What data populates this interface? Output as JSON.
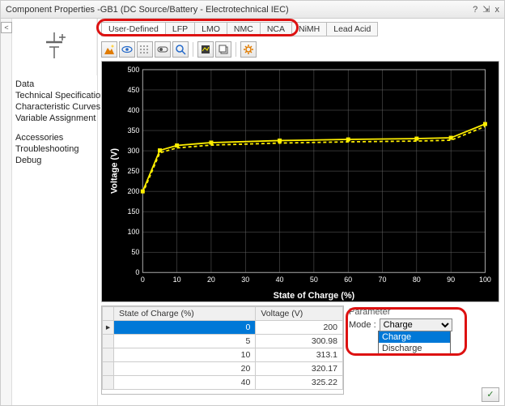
{
  "window": {
    "title": "Component Properties -GB1 (DC Source/Battery - Electrotechnical IEC)",
    "help_glyph": "?",
    "pin_glyph": "⇲",
    "close_glyph": "x"
  },
  "sidebar": {
    "collapse_glyph": "<",
    "nav": {
      "data": "Data",
      "tech_spec": "Technical Specifications",
      "curves": "Characteristic Curves",
      "var_assign": "Variable Assignment",
      "accessories": "Accessories",
      "troubleshooting": "Troubleshooting",
      "debug": "Debug"
    }
  },
  "tabs": {
    "user_defined": "User-Defined",
    "lfp": "LFP",
    "lmo": "LMO",
    "nmc": "NMC",
    "nca": "NCA",
    "nimh": "NiMH",
    "lead_acid": "Lead Acid"
  },
  "toolbar": {
    "icon1": "mountain-icon",
    "icon2": "eye-icon",
    "icon3": "grid-dash-icon",
    "icon4": "toggle-icon",
    "icon5": "zoom-icon",
    "icon6": "style-icon",
    "icon7": "copy-icon",
    "icon8": "gear-icon"
  },
  "chart_data": {
    "type": "line",
    "xlabel": "State of Charge (%)",
    "ylabel": "Voltage (V)",
    "xlim": [
      0,
      100
    ],
    "ylim": [
      0,
      500
    ],
    "xticks": [
      0,
      10,
      20,
      30,
      40,
      50,
      60,
      70,
      80,
      90,
      100
    ],
    "yticks": [
      0,
      50,
      100,
      150,
      200,
      250,
      300,
      350,
      400,
      450,
      500
    ],
    "series": [
      {
        "name": "solid",
        "style": "solid",
        "x": [
          0,
          5,
          10,
          20,
          40,
          60,
          80,
          90,
          100
        ],
        "y": [
          200,
          300.98,
          313.1,
          320.17,
          325.22,
          328,
          330,
          332,
          366
        ]
      },
      {
        "name": "dashed",
        "style": "dashed",
        "x": [
          0,
          5,
          10,
          20,
          40,
          60,
          80,
          90,
          100
        ],
        "y": [
          195,
          295,
          307,
          314,
          319,
          322,
          324,
          326,
          360
        ]
      }
    ],
    "colors": {
      "line": "#ffef00",
      "marker": "#ffef00",
      "grid": "#666",
      "bg": "#000"
    }
  },
  "table": {
    "col_soc": "State of Charge (%)",
    "col_voltage": "Voltage (V)",
    "row_marker": "▸",
    "rows": [
      {
        "soc": "0",
        "v": "200"
      },
      {
        "soc": "5",
        "v": "300.98"
      },
      {
        "soc": "10",
        "v": "313.1"
      },
      {
        "soc": "20",
        "v": "320.17"
      },
      {
        "soc": "40",
        "v": "325.22"
      }
    ]
  },
  "params": {
    "header": "Parameter",
    "mode_label": "Mode :",
    "mode_value": "Charge",
    "options": {
      "charge": "Charge",
      "discharge": "Discharge"
    }
  },
  "footer": {
    "ok_glyph": "✓"
  }
}
